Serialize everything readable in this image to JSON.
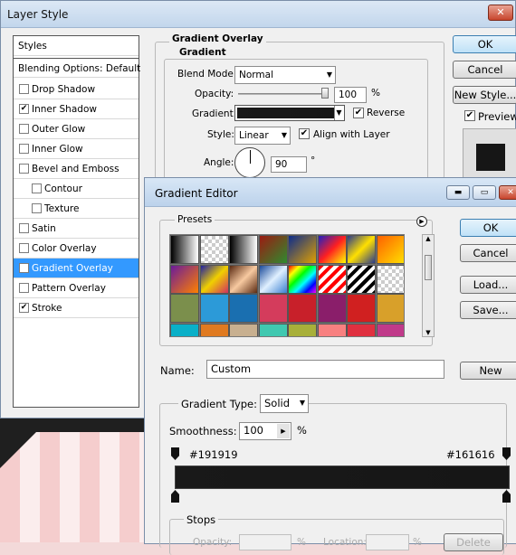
{
  "layer_style": {
    "title": "Layer Style",
    "styles_header": "Styles",
    "blending_options": "Blending Options: Default",
    "styles": [
      {
        "label": "Drop Shadow",
        "checked": false
      },
      {
        "label": "Inner Shadow",
        "checked": true
      },
      {
        "label": "Outer Glow",
        "checked": false
      },
      {
        "label": "Inner Glow",
        "checked": false
      },
      {
        "label": "Bevel and Emboss",
        "checked": false
      },
      {
        "label": "Contour",
        "checked": false,
        "indent": true
      },
      {
        "label": "Texture",
        "checked": false,
        "indent": true
      },
      {
        "label": "Satin",
        "checked": false
      },
      {
        "label": "Color Overlay",
        "checked": false
      },
      {
        "label": "Gradient Overlay",
        "checked": true,
        "selected": true
      },
      {
        "label": "Pattern Overlay",
        "checked": false
      },
      {
        "label": "Stroke",
        "checked": true
      }
    ],
    "section_title": "Gradient Overlay",
    "group_title": "Gradient",
    "blend_mode_label": "Blend Mode:",
    "blend_mode_value": "Normal",
    "opacity_label": "Opacity:",
    "opacity_value": "100",
    "opacity_unit": "%",
    "gradient_label": "Gradient:",
    "reverse_label": "Reverse",
    "reverse_checked": true,
    "style_label": "Style:",
    "style_value": "Linear",
    "align_label": "Align with Layer",
    "align_checked": true,
    "angle_label": "Angle:",
    "angle_value": "90",
    "angle_unit": "°",
    "buttons": {
      "ok": "OK",
      "cancel": "Cancel",
      "new_style": "New Style..."
    },
    "preview_label": "Preview",
    "preview_checked": true
  },
  "gradient_editor": {
    "title": "Gradient Editor",
    "presets_label": "Presets",
    "buttons": {
      "ok": "OK",
      "cancel": "Cancel",
      "load": "Load...",
      "save": "Save...",
      "new": "New"
    },
    "name_label": "Name:",
    "name_value": "Custom",
    "gradient_type_label": "Gradient Type:",
    "gradient_type_value": "Solid",
    "smoothness_label": "Smoothness:",
    "smoothness_value": "100",
    "smoothness_unit": "%",
    "stop_left_color": "#191919",
    "stop_right_color": "#161616",
    "stops_label": "Stops",
    "stops_opacity_label": "Opacity:",
    "stops_location_label": "Location:",
    "stops_percent": "%",
    "delete_label": "Delete"
  }
}
